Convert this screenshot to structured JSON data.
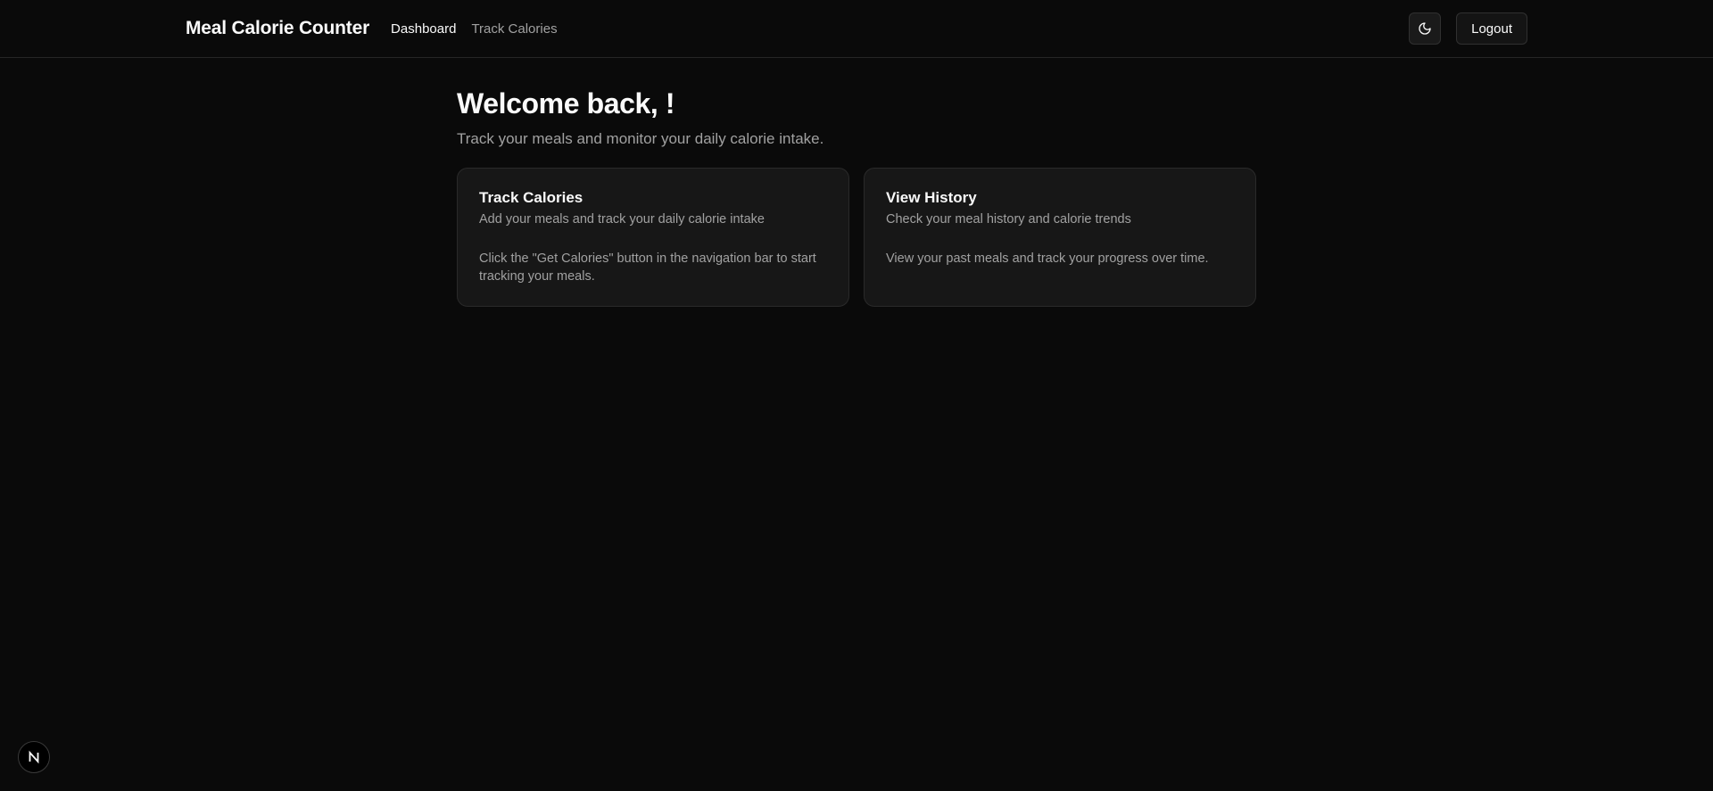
{
  "nav": {
    "brand": "Meal Calorie Counter",
    "links": [
      {
        "label": "Dashboard",
        "active": true
      },
      {
        "label": "Track Calories",
        "active": false
      }
    ],
    "theme_toggle_icon": "moon-icon",
    "logout_label": "Logout"
  },
  "main": {
    "welcome": "Welcome back, !",
    "subtitle": "Track your meals and monitor your daily calorie intake.",
    "cards": [
      {
        "title": "Track Calories",
        "description": "Add your meals and track your daily calorie intake",
        "body": "Click the \"Get Calories\" button in the navigation bar to start tracking your meals."
      },
      {
        "title": "View History",
        "description": "Check your meal history and calorie trends",
        "body": "View your past meals and track your progress over time."
      }
    ]
  },
  "dev_badge": {
    "icon": "nextjs-logo-icon",
    "letter": "N"
  },
  "colors": {
    "background": "#0a0a0a",
    "card_background": "#171717",
    "border": "#262626",
    "text_primary": "#fafafa",
    "text_muted": "#a1a1a1"
  }
}
